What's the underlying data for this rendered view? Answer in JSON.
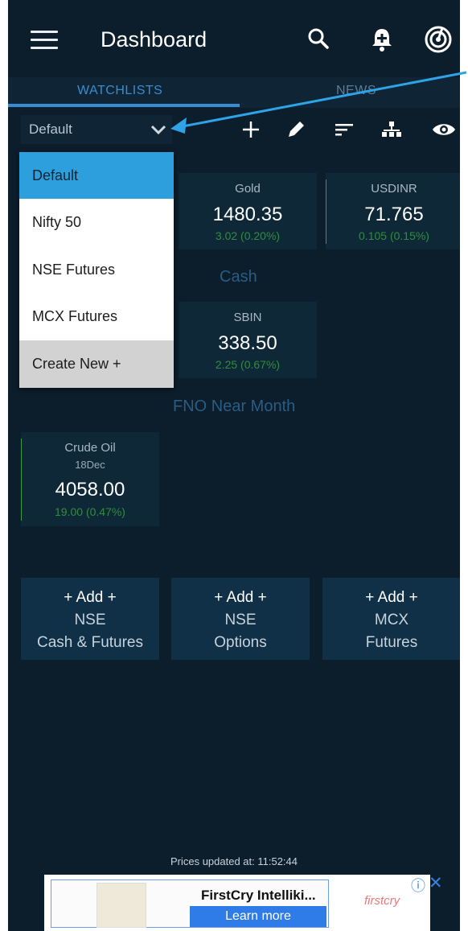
{
  "header": {
    "title": "Dashboard"
  },
  "tabs": {
    "watchlists": "WATCHLISTS",
    "news": "NEWS"
  },
  "watchlist_selector": {
    "value": "Default"
  },
  "dropdown_items": [
    "Default",
    "Nifty 50",
    "NSE Futures",
    "MCX Futures",
    "Create New +"
  ],
  "cards": {
    "gold": {
      "name": "Gold",
      "price": "1480.35",
      "change": "3.02 (0.20%)"
    },
    "usdinr": {
      "name": "USDINR",
      "price": "71.765",
      "change": "0.105 (0.15%)"
    },
    "sbin": {
      "name": "SBIN",
      "price": "338.50",
      "change": "2.25 (0.67%)"
    },
    "crude": {
      "name": "Crude Oil",
      "expiry": "18Dec",
      "price": "4058.00",
      "change": "19.00 (0.47%)"
    }
  },
  "sections": {
    "cash": "Cash",
    "fno": "FNO Near Month"
  },
  "add_boxes": [
    {
      "head": "+ Add +",
      "line1": "NSE",
      "line2": "Cash & Futures"
    },
    {
      "head": "+ Add +",
      "line1": "NSE",
      "line2": "Options"
    },
    {
      "head": "+ Add +",
      "line1": "MCX",
      "line2": "Futures"
    }
  ],
  "footer": {
    "updated": "Prices updated at:  11:52:44"
  },
  "ad": {
    "title": "FirstCry Intelliki...",
    "button": "Learn more",
    "logo": "firstcry"
  },
  "colors": {
    "background": "#0c1d2b",
    "accent": "#3a8cd0",
    "positive": "#2f8e3c",
    "dropdown_active": "#2d9fdc"
  }
}
